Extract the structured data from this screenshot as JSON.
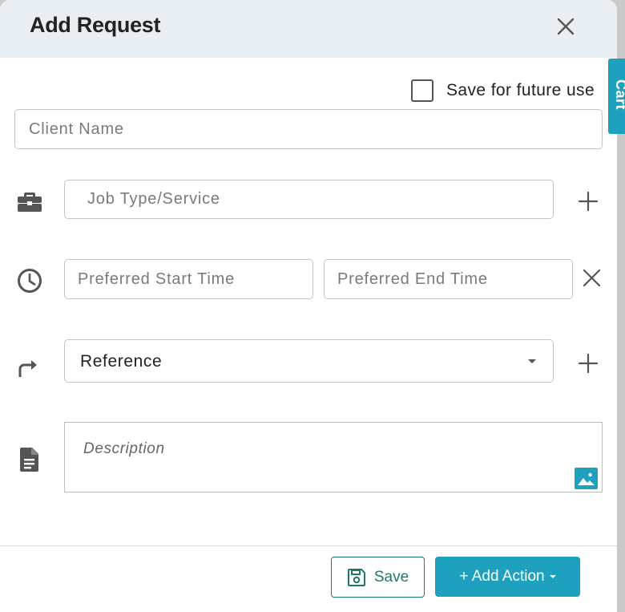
{
  "modal": {
    "title": "Add Request",
    "save_for_future_label": "Save for future use",
    "save_for_future_checked": false
  },
  "form": {
    "client_name": {
      "value": "",
      "placeholder": "Client Name"
    },
    "job_type": {
      "value": "",
      "placeholder": "Job Type/Service"
    },
    "preferred_start": {
      "value": "",
      "placeholder": "Preferred Start Time"
    },
    "preferred_end": {
      "value": "",
      "placeholder": "Preferred End Time"
    },
    "reference": {
      "selected": "Reference"
    },
    "description": {
      "value": "",
      "placeholder": "Description"
    }
  },
  "icons": {
    "job_type": "briefcase-icon",
    "time": "clock-icon",
    "reference": "turn-right-arrow-icon",
    "description": "document-icon",
    "add": "plus-icon",
    "clear": "close-icon",
    "image": "image-icon",
    "save": "floppy-disk-icon"
  },
  "footer": {
    "save_label": "Save",
    "add_action_label": "+ Add Action"
  },
  "side_tab": {
    "label": "Cart"
  },
  "colors": {
    "header_bg": "#e8eef1",
    "accent": "#1ea1bf",
    "save_green": "#1d7a6a"
  }
}
